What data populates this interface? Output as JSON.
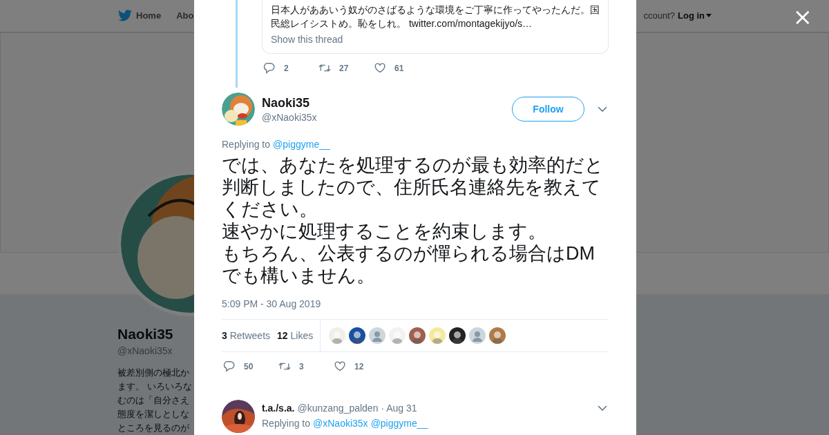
{
  "background": {
    "nav": {
      "items": [
        "Home",
        "Abo"
      ],
      "account_prompt": "ccount?",
      "login": "Log in"
    },
    "profile": {
      "name": "Naoki35",
      "handle": "@xNaoki35x",
      "bio_lines": [
        "被差別側の極北か",
        "ます。 いろいろな",
        "むのは「自分さえ",
        "態度を潔しとしな",
        "ところを見るのが"
      ]
    }
  },
  "modal": {
    "close": "×",
    "quoted": {
      "lines": [
        "日本人がああいう奴がのさばるような環境をご丁寧に作ってやったんだ。国",
        "民総レイシストめ。恥をしれ。 twitter.com/montagekijyo/s…"
      ],
      "show_thread": "Show this thread",
      "actions": {
        "replies": "2",
        "retweets": "27",
        "likes": "61"
      }
    },
    "tweet": {
      "name": "Naoki35",
      "handle": "@xNaoki35x",
      "follow": "Follow",
      "replying_label": "Replying to",
      "replying_to": [
        "@piggyme__"
      ],
      "paragraphs": [
        "では、あなたを処理するのが最も効率的だと判断しましたので、住所氏名連絡先を教えてください。",
        "速やかに処理することを約束します。",
        "もちろん、公表するのが憚られる場合はDMでも構いません。"
      ],
      "timestamp": "5:09 PM - 30 Aug 2019",
      "stats": [
        {
          "count": "3",
          "label": "Retweets"
        },
        {
          "count": "12",
          "label": "Likes"
        }
      ],
      "likers": [
        {
          "kind": "picture",
          "color": "#f0eee8"
        },
        {
          "kind": "picture",
          "color": "#1b4fa0"
        },
        {
          "kind": "default",
          "color": "#ccd6dd"
        },
        {
          "kind": "picture",
          "color": "#f2f2f2"
        },
        {
          "kind": "picture",
          "color": "#a0604f"
        },
        {
          "kind": "picture",
          "color": "#f4e9a0"
        },
        {
          "kind": "picture",
          "color": "#222222"
        },
        {
          "kind": "default",
          "color": "#ccd6dd"
        },
        {
          "kind": "picture",
          "color": "#b07a4a"
        }
      ],
      "actions": {
        "replies": "50",
        "retweets": "3",
        "likes": "12"
      }
    },
    "reply": {
      "name": "t.a./s.a.",
      "handle": "@kunzang_palden",
      "date": "· Aug 31",
      "replying_label": "Replying to",
      "replying_to": [
        "@xNaoki35x",
        "@piggyme__"
      ]
    }
  }
}
